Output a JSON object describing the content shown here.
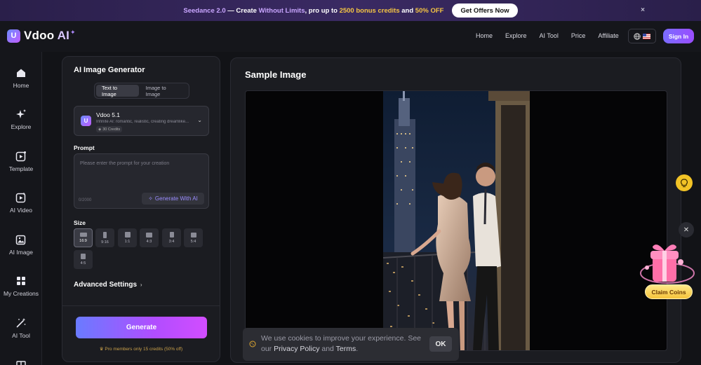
{
  "promo": {
    "part1": "Seedance 2.0",
    "part2": " — Create ",
    "part3": "Without Limits",
    "part4": ", pro up to ",
    "part5": "2500 bonus credits",
    "part6": " and ",
    "part7": "50% OFF",
    "button": "Get Offers Now",
    "close": "×"
  },
  "header": {
    "logo": "Vdoo",
    "logo_ai": "AI",
    "nav": [
      "Home",
      "Explore",
      "AI Tool",
      "Price",
      "Affiliate"
    ],
    "signin": "Sign In"
  },
  "sidebar": {
    "items": [
      {
        "label": "Home",
        "icon": "home-icon"
      },
      {
        "label": "Explore",
        "icon": "sparkle-icon"
      },
      {
        "label": "Template",
        "icon": "template-icon"
      },
      {
        "label": "AI Video",
        "icon": "video-icon"
      },
      {
        "label": "AI Image",
        "icon": "image-icon"
      },
      {
        "label": "My Creations",
        "icon": "grid-icon"
      },
      {
        "label": "AI Tool",
        "icon": "magic-wand-icon"
      }
    ]
  },
  "generator": {
    "title": "AI Image Generator",
    "tabs": [
      "Text to Image",
      "Image to Image"
    ],
    "model": {
      "name": "Vdoo 5.1",
      "desc": "Infinite AI: romantic, realistic, creating dreamlike...",
      "credits": "30 Credits"
    },
    "prompt_label": "Prompt",
    "prompt_placeholder": "Please enter the prompt for your creation",
    "char_count": "0/2000",
    "generate_ai": "Generate With AI",
    "size_label": "Size",
    "sizes": [
      "16:9",
      "9:16",
      "1:1",
      "4:3",
      "3:4",
      "5:4",
      "4:5"
    ],
    "selected_size": "16:9",
    "advanced": "Advanced Settings",
    "generate": "Generate",
    "pro_note": "Pro members only 15 credits (50% off)"
  },
  "sample": {
    "title": "Sample Image"
  },
  "floating": {
    "claim": "Claim Coins"
  },
  "cookie": {
    "text1": "We use cookies to improve your experience. See our ",
    "privacy": "Privacy Policy",
    "and": " and ",
    "terms": "Terms",
    "dot": ".",
    "ok": "OK"
  }
}
